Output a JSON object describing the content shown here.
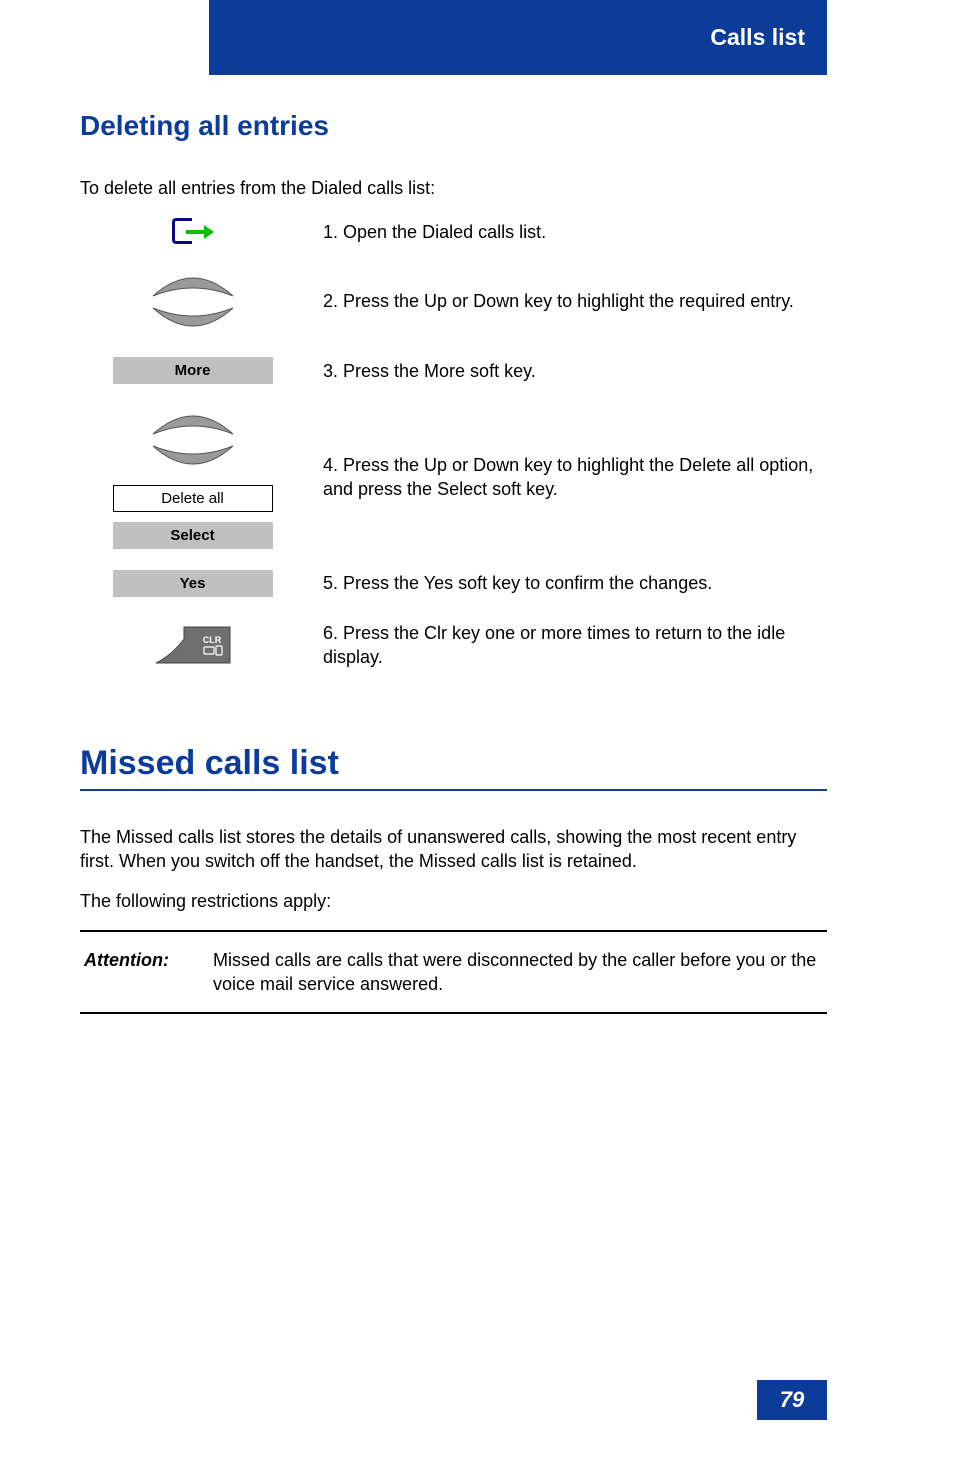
{
  "header": {
    "title": "Calls list"
  },
  "section1": {
    "title": "Deleting all entries",
    "intro": "To delete all entries from the Dialed calls list:",
    "steps": [
      {
        "icon": "dialed-calls-icon",
        "text": "1. Open the Dialed calls list."
      },
      {
        "icon": "rocker-icon",
        "text": "2. Press the Up or Down key to highlight the required entry."
      },
      {
        "icon": "softkey",
        "label": "More",
        "text": "3. Press the More soft key."
      },
      {
        "icon": "menu+softkey",
        "menu": "Delete all",
        "label": "Select",
        "text": "4. Press the Up or Down key to highlight the Delete all option, and press the Select soft key."
      },
      {
        "icon": "softkey",
        "label": "Yes",
        "text": "5. Press the Yes soft key to confirm the changes."
      },
      {
        "icon": "clr-key-icon",
        "text": "6. Press the Clr key one or more times to return to the idle display."
      }
    ]
  },
  "section2": {
    "title": "Missed calls list",
    "p1": "The Missed calls list stores the details of unanswered calls, showing the most recent entry first. When you switch off the handset, the Missed calls list is retained.",
    "p2": "The following restrictions apply:",
    "attention_label": "Attention:",
    "attention_text": "Missed calls are calls that were disconnected by the caller before you or the voice mail service answered."
  },
  "page_number": "79"
}
